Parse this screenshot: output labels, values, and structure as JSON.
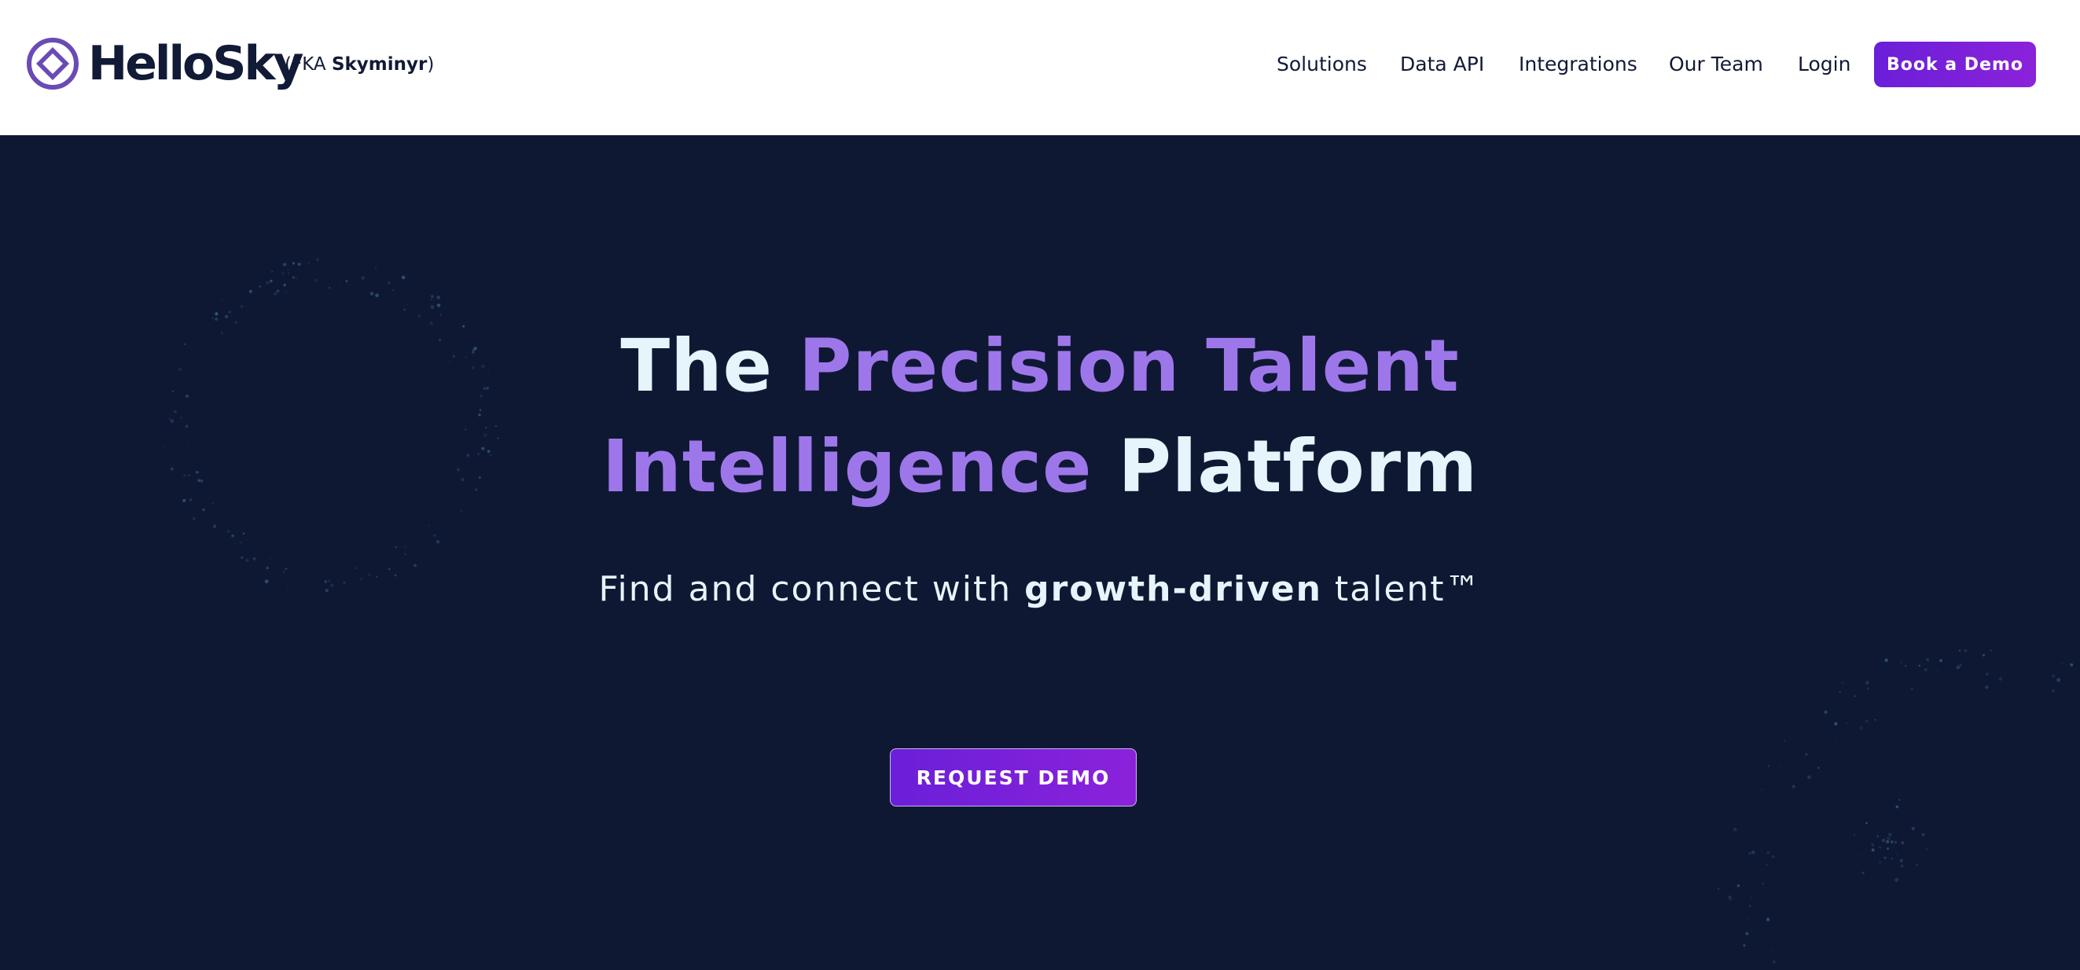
{
  "colors": {
    "header_bg": "#ffffff",
    "hero_bg": "#0f1833",
    "text_dark": "#111a36",
    "text_light": "#e6f4fb",
    "accent_purple": "#9d77ea",
    "button_gradient_start": "#6a1fd8",
    "button_gradient_end": "#8b22da"
  },
  "header": {
    "logo_icon": "hellosky-diamond-logo-icon",
    "brand_name": "HelloSky",
    "fka_prefix": "(FKA ",
    "fka_name": "Skyminyr",
    "fka_suffix": ")",
    "nav": [
      "Solutions",
      "Data API",
      "Integrations",
      "Our Team",
      "Login"
    ],
    "cta_label": "Book a Demo"
  },
  "hero": {
    "headline_part1": "The ",
    "headline_highlight1": "Precision Talent",
    "headline_highlight2": "Intelligence",
    "headline_part2": " Platform",
    "subhead_part1": "Find and connect with ",
    "subhead_bold": "growth-driven",
    "subhead_part2": " talent™",
    "cta_label": "REQUEST DEMO"
  }
}
